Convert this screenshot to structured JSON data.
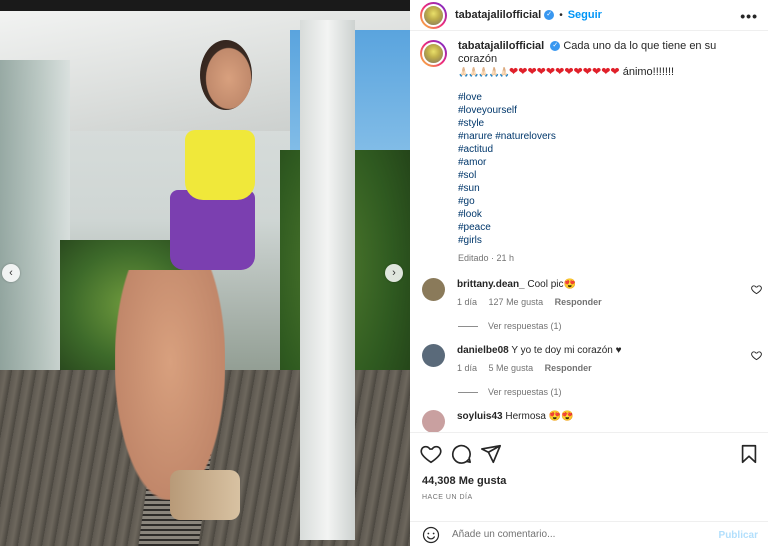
{
  "post": {
    "username": "tabatajalilofficial",
    "follow_label": "Seguir",
    "more_label": "•••",
    "verified_mark": "✓"
  },
  "caption": {
    "username": "tabatajalilofficial",
    "text": "Cada uno da lo que tiene en su corazón",
    "emoji_line": "🙏🏻🙏🏻🙏🏻🙏🏻🙏🏻",
    "hearts": "❤❤❤❤❤❤❤❤❤❤❤❤",
    "text_end": "ánimo!!!!!!!",
    "hashtags": [
      "#love",
      "#loveyourself",
      "#style",
      "#narure #naturelovers",
      "#actitud",
      "#amor",
      "#sol",
      "#sun",
      "#go",
      "#look",
      "#peace",
      "#girls"
    ],
    "edited": "Editado · 21 h"
  },
  "comments": [
    {
      "username": "brittany.dean_",
      "text": "Cool pic😍",
      "time": "1 día",
      "likes": "127 Me gusta",
      "reply_label": "Responder",
      "view_replies": "Ver respuestas (1)",
      "avatar_color": "#8a7a5a"
    },
    {
      "username": "danielbe08",
      "text": "Y yo te doy mi corazón ♥",
      "time": "1 día",
      "likes": "5 Me gusta",
      "reply_label": "Responder",
      "view_replies": "Ver respuestas (1)",
      "avatar_color": "#5a6a7a"
    },
    {
      "username": "soyluis43",
      "text": "Hermosa 😍😍",
      "avatar_color": "#c9a0a0"
    }
  ],
  "footer": {
    "likes": "44,308 Me gusta",
    "time_ago": "HACE UN DÍA",
    "comment_placeholder": "Añade un comentario...",
    "publish_label": "Publicar"
  },
  "nav": {
    "prev": "‹",
    "next": "›"
  },
  "colors": {
    "link": "#0095f6",
    "hashtag": "#00376b",
    "heart": "#e0202a"
  },
  "icons": [
    "heart-icon",
    "comment-icon",
    "share-icon",
    "bookmark-icon",
    "emoji-icon",
    "verified-icon",
    "more-icon"
  ]
}
